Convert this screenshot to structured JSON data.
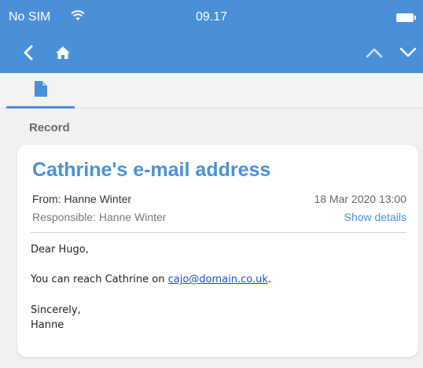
{
  "status_bar": {
    "carrier": "No SIM",
    "time": "09.17",
    "icons": [
      "wifi-icon",
      "battery-icon"
    ]
  },
  "nav_bar": {
    "icons": [
      "back-chevron-icon",
      "home-icon",
      "chevron-up-icon",
      "chevron-down-icon"
    ]
  },
  "tabs": [
    {
      "icon": "document-icon",
      "active": true
    }
  ],
  "section": {
    "label": "Record"
  },
  "record": {
    "title": "Cathrine's e-mail address",
    "from": "From: Hanne Winter",
    "date": "18 Mar 2020 13:00",
    "responsible": "Responsible: Hanne Winter",
    "show_details": "Show details",
    "body": {
      "greeting": "Dear Hugo,",
      "line_prefix": "You can reach Cathrine on ",
      "email": "cajo@domain.co.uk",
      "line_suffix": ".",
      "closing": "Sincerely,",
      "signature": "Hanne"
    }
  },
  "colors": {
    "accent": "#4a90d9",
    "link": "#1a4fd6",
    "background": "#f1f1f1"
  }
}
